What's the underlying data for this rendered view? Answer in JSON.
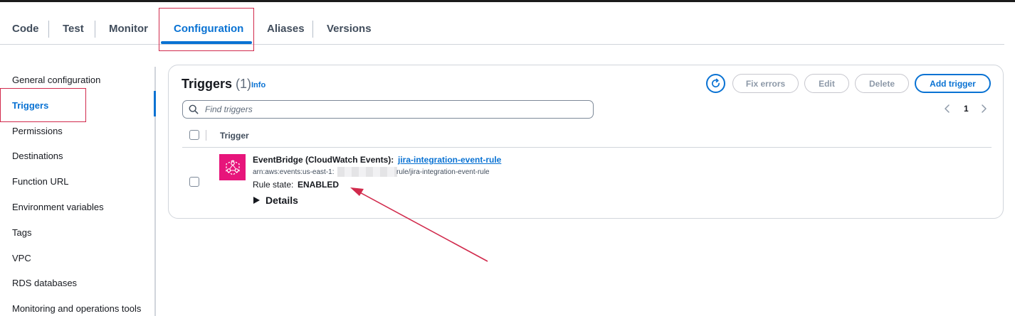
{
  "tabs": [
    {
      "label": "Code"
    },
    {
      "label": "Test"
    },
    {
      "label": "Monitor"
    },
    {
      "label": "Configuration"
    },
    {
      "label": "Aliases"
    },
    {
      "label": "Versions"
    }
  ],
  "active_tab": "Configuration",
  "sidenav": {
    "items": [
      {
        "label": "General configuration"
      },
      {
        "label": "Triggers"
      },
      {
        "label": "Permissions"
      },
      {
        "label": "Destinations"
      },
      {
        "label": "Function URL"
      },
      {
        "label": "Environment variables"
      },
      {
        "label": "Tags"
      },
      {
        "label": "VPC"
      },
      {
        "label": "RDS databases"
      },
      {
        "label": "Monitoring and operations tools"
      }
    ],
    "active_item": "Triggers"
  },
  "panel": {
    "title": "Triggers",
    "count": "(1)",
    "info_label": "Info",
    "buttons": {
      "refresh_icon": "refresh-icon",
      "fix_errors": "Fix errors",
      "edit": "Edit",
      "delete": "Delete",
      "add_trigger": "Add trigger"
    },
    "search": {
      "placeholder": "Find triggers",
      "value": ""
    },
    "pagination": {
      "page": "1"
    },
    "table": {
      "header": "Trigger",
      "rows": [
        {
          "icon": "eventbridge-icon",
          "source": "EventBridge (CloudWatch Events):",
          "link": "jira-integration-event-rule",
          "arn_prefix": "arn:aws:events:us-east-1:",
          "arn_suffix": "rule/jira-integration-event-rule",
          "rule_state_label": "Rule state:",
          "rule_state_value": "ENABLED",
          "details_label": "Details"
        }
      ]
    }
  },
  "colors": {
    "accent": "#0972d3",
    "annotation": "#d12a4c",
    "eventbridge": "#e7157b"
  }
}
